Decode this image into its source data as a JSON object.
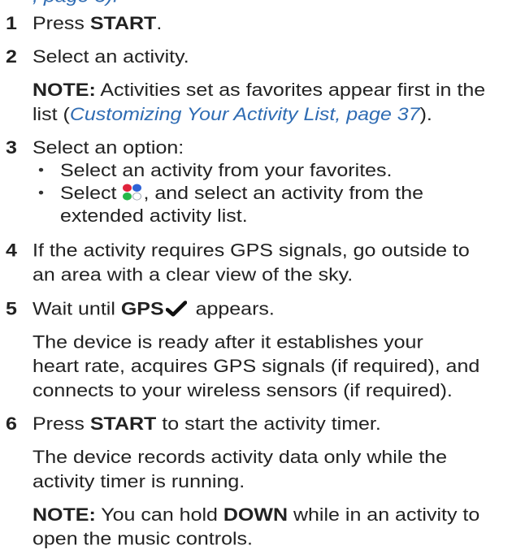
{
  "header_fragment": ", page 5).",
  "steps": [
    {
      "num": "1",
      "pre": "Press ",
      "bold": "START",
      "post": "."
    },
    {
      "num": "2",
      "text": "Select an activity.",
      "note_label": "NOTE:",
      "note_line1": " Activities set as favorites appear first in the",
      "note_line2_pre": "list (",
      "note_link": "Customizing Your Activity List, page 37",
      "note_line2_post": ")."
    },
    {
      "num": "3",
      "text": "Select an option:",
      "bullet1": "Select an activity from your favorites.",
      "bullet2_pre": "Select ",
      "bullet2_post": ", and select an activity from the",
      "bullet2_cont": "extended activity list.",
      "bullet_icon": "activities-icon"
    },
    {
      "num": "4",
      "line1": "If the activity requires GPS signals, go outside to",
      "line2": "an area with a clear view of the sky."
    },
    {
      "num": "5",
      "pre": "Wait until ",
      "bold": "GPS",
      "post": " appears.",
      "check_icon": "check-icon",
      "para1": "The device is ready after it establishes your",
      "para2": "heart rate, acquires GPS signals (if required), and",
      "para3": "connects to your wireless sensors (if required)."
    },
    {
      "num": "6",
      "pre": "Press ",
      "bold": "START",
      "post": " to start the activity timer.",
      "para1": "The device records activity data only while the",
      "para2": "activity timer is running.",
      "note_label": "NOTE:",
      "note_pre": " You can hold ",
      "note_bold": "DOWN",
      "note_post": " while in an activity to",
      "note_cont": "open the music controls."
    }
  ],
  "colors": {
    "text": "#222222",
    "link": "#2f6cb3"
  }
}
